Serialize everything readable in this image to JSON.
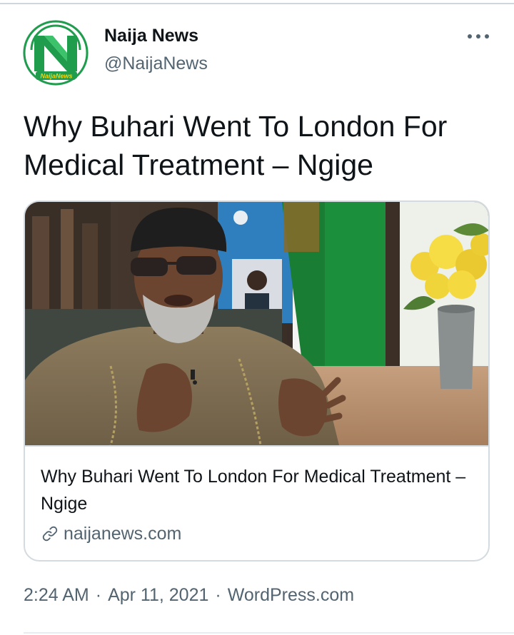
{
  "account": {
    "name": "Naija News",
    "handle": "@NaijaNews",
    "avatar_wordmark": "NaijaNews",
    "brand_green": "#1f9d4d"
  },
  "tweet": {
    "text": "Why Buhari Went To London For Medical Treatment – Ngige"
  },
  "card": {
    "title": "Why Buhari Went To London For Medical Treatment – Ngige",
    "domain": "naijanews.com",
    "image_icon": "photo-man-speaking"
  },
  "meta": {
    "time": "2:24 AM",
    "separator": "·",
    "date": "Apr 11, 2021",
    "source": "WordPress.com"
  },
  "icons": {
    "more": "more-horizontal-icon",
    "link": "link-icon"
  }
}
